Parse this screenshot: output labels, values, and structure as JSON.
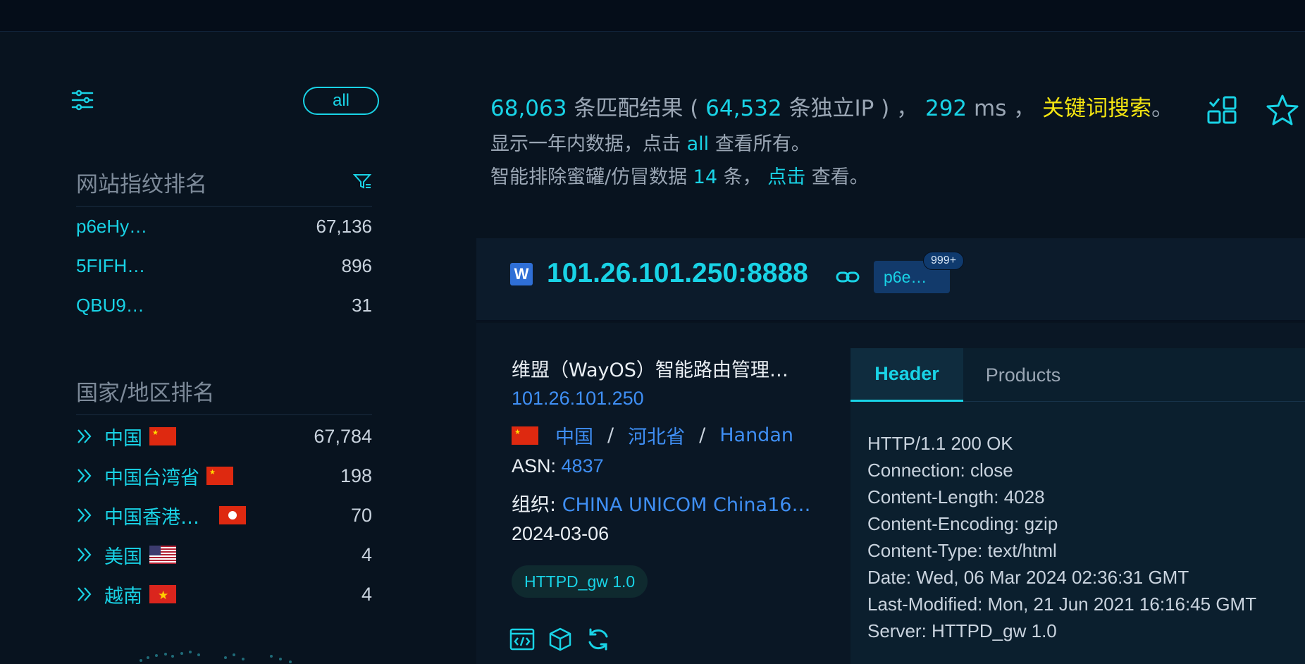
{
  "sidebar": {
    "all_label": "all",
    "fingerprint_title": "网站指纹排名",
    "fingerprints": [
      {
        "name": "p6eHy…",
        "count": "67,136"
      },
      {
        "name": "5FIFH…",
        "count": "896"
      },
      {
        "name": "QBU9…",
        "count": "31"
      }
    ],
    "country_title": "国家/地区排名",
    "countries": [
      {
        "name": "中国",
        "count": "67,784",
        "flag": "cn"
      },
      {
        "name": "中国台湾省",
        "count": "198",
        "flag": "cn"
      },
      {
        "name": "中国香港…",
        "count": "70",
        "flag": "hk"
      },
      {
        "name": "美国",
        "count": "4",
        "flag": "us"
      },
      {
        "name": "越南",
        "count": "4",
        "flag": "vn"
      }
    ]
  },
  "summary": {
    "count": "68,063",
    "count_text": " 条匹配结果 ( ",
    "unique": "64,532",
    "unique_text": " 条独立IP ) ， ",
    "ms": "292",
    "ms_text": " ms ， ",
    "keyword": "关键词搜索",
    "period": "。",
    "line2_pre": "显示一年内数据，点击 ",
    "line2_all": "all",
    "line2_post": " 查看所有。",
    "line3_pre": "智能排除蜜罐/仿冒数据 ",
    "line3_count": "14",
    "line3_mid": " 条， ",
    "line3_click": "点击",
    "line3_post": " 查看。"
  },
  "result": {
    "logo_letter": "W",
    "host": "101.26.101.250:8888",
    "tag": "p6e…",
    "badge": "999+",
    "title": "维盟（WayOS）智能路由管理…",
    "ip": "101.26.101.250",
    "country": "中国",
    "sep": "/",
    "province": "河北省",
    "city": "Handan",
    "asn_label": "ASN: ",
    "asn": "4837",
    "org_label": "组织: ",
    "org": "CHINA UNICOM China16…",
    "date": "2024-03-06",
    "server_tag": "HTTPD_gw 1.0"
  },
  "tabs": {
    "active": "Header",
    "inactive": "Products"
  },
  "header_lines": [
    "HTTP/1.1 200 OK",
    "Connection: close",
    "Content-Length: 4028",
    "Content-Encoding: gzip",
    "Content-Type: text/html",
    "Date: Wed, 06 Mar 2024 02:36:31 GMT",
    "Last-Modified: Mon, 21 Jun 2021 16:16:45 GMT",
    "Server: HTTPD_gw 1.0"
  ],
  "colors": {
    "accent": "#19d3e6",
    "link": "#3f8ff5",
    "keyword": "#f4e511",
    "background": "#07111f"
  },
  "icons": [
    "sliders-icon",
    "filter-funnel-icon",
    "chevron-double-right-icon",
    "grid-icon",
    "star-icon",
    "link-icon",
    "code-icon",
    "cube-icon",
    "refresh-icon"
  ]
}
